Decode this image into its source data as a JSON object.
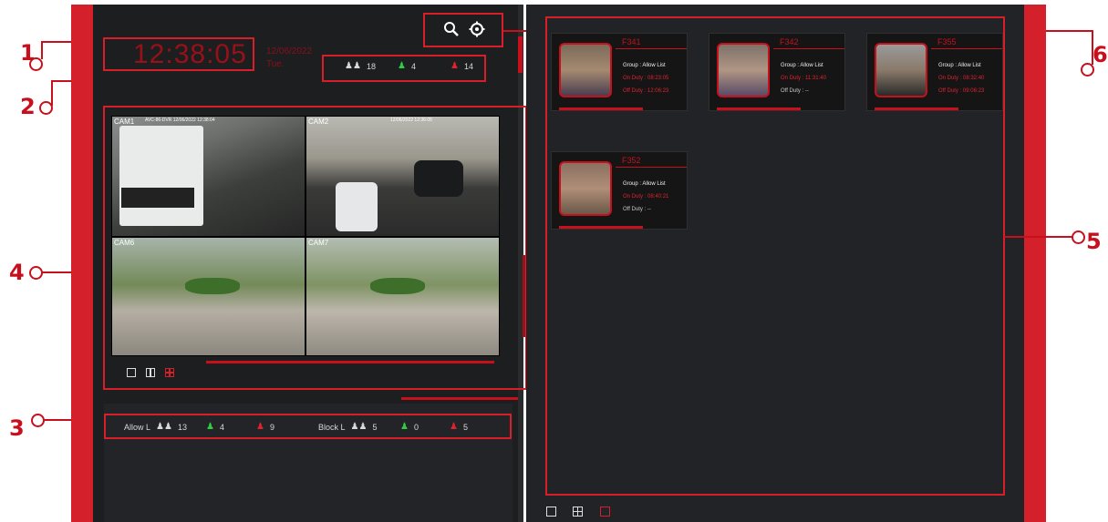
{
  "time": "12:38:05",
  "date": "12/06/2022",
  "weekday": "Tue.",
  "stats": {
    "total": "18",
    "green": "4",
    "red": "14"
  },
  "lists": {
    "allow_label": "Allow L",
    "allow_total": "13",
    "allow_green": "4",
    "allow_red": "9",
    "block_label": "Block L",
    "block_total": "5",
    "block_green": "0",
    "block_red": "5"
  },
  "cameras": [
    {
      "label": "CAM1",
      "overlay": "AVC-86-DVR  12/06/2022 12:38:04"
    },
    {
      "label": "CAM2",
      "overlay": "12/06/2022 12:36:05"
    },
    {
      "label": "CAM6",
      "overlay": ""
    },
    {
      "label": "CAM7",
      "overlay": ""
    }
  ],
  "cards": [
    {
      "id": "F341",
      "group": "Group  : Allow List",
      "on": "On Duty  : 08:23:05",
      "off": "Off Duty  : 12:06:23"
    },
    {
      "id": "F342",
      "group": "Group  : Allow List",
      "on": "On Duty  : 11:31:40",
      "off": "Off Duty  :  --"
    },
    {
      "id": "F355",
      "group": "Group  : Allow List",
      "on": "On Duty  : 08:32:40",
      "off": "Off Duty  : 09:06:23"
    },
    {
      "id": "F352",
      "group": "Group  : Allow List",
      "on": "On Duty  : 08:40:21",
      "off": "Off Duty  :  --"
    }
  ],
  "callouts": {
    "c1": "1",
    "c2": "2",
    "c3": "3",
    "c4": "4",
    "c5": "5",
    "c6": "6"
  },
  "colors": {
    "accent": "#d4202a",
    "background": "#1d1e20",
    "green": "#2ecc40"
  },
  "icons": [
    "search-icon",
    "gear-icon",
    "people-icon",
    "person-icon",
    "single-view-icon",
    "split-view-icon",
    "quad-view-icon",
    "grid-view-icon"
  ]
}
